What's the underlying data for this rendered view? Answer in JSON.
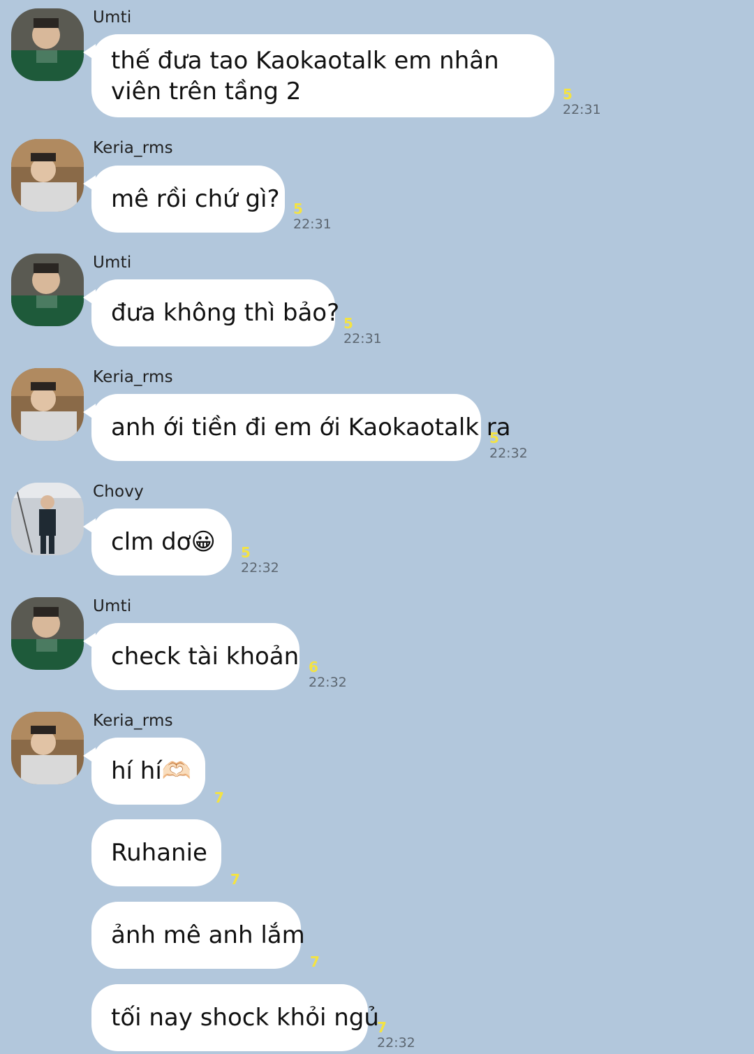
{
  "messages": [
    {
      "sender": "Umti",
      "text": "thế đưa tao Kaokaotalk em nhân viên trên tầng 2",
      "unread": "5",
      "time": "22:31"
    },
    {
      "sender": "Keria_rms",
      "text": "mê rồi chứ gì?",
      "unread": "5",
      "time": "22:31"
    },
    {
      "sender": "Umti",
      "text": "đưa không thì bảo?",
      "unread": "5",
      "time": "22:31"
    },
    {
      "sender": "Keria_rms",
      "text": "anh ới tiền đi em ới Kaokaotalk ra",
      "unread": "5",
      "time": "22:32"
    },
    {
      "sender": "Chovy",
      "text": "clm dơ😀",
      "unread": "5",
      "time": "22:32"
    },
    {
      "sender": "Umti",
      "text": "check tài khoản",
      "unread": "6",
      "time": "22:32"
    },
    {
      "sender": "Keria_rms",
      "text": "hí hí🫶🏻",
      "unread": "7",
      "time": ""
    },
    {
      "sender": "",
      "text": "Ruhanie",
      "unread": "7",
      "time": ""
    },
    {
      "sender": "",
      "text": "ảnh mê anh lắm",
      "unread": "7",
      "time": ""
    },
    {
      "sender": "",
      "text": "tối nay shock khỏi ngủ",
      "unread": "7",
      "time": "22:32"
    }
  ],
  "colors": {
    "background": "#b2c7dc",
    "bubble": "#ffffff",
    "unread": "#f4e342",
    "time": "#5c6670"
  },
  "icons": {
    "avatar_umti": "avatar-umti-icon",
    "avatar_keria": "avatar-keria-icon",
    "avatar_chovy": "avatar-chovy-icon"
  }
}
